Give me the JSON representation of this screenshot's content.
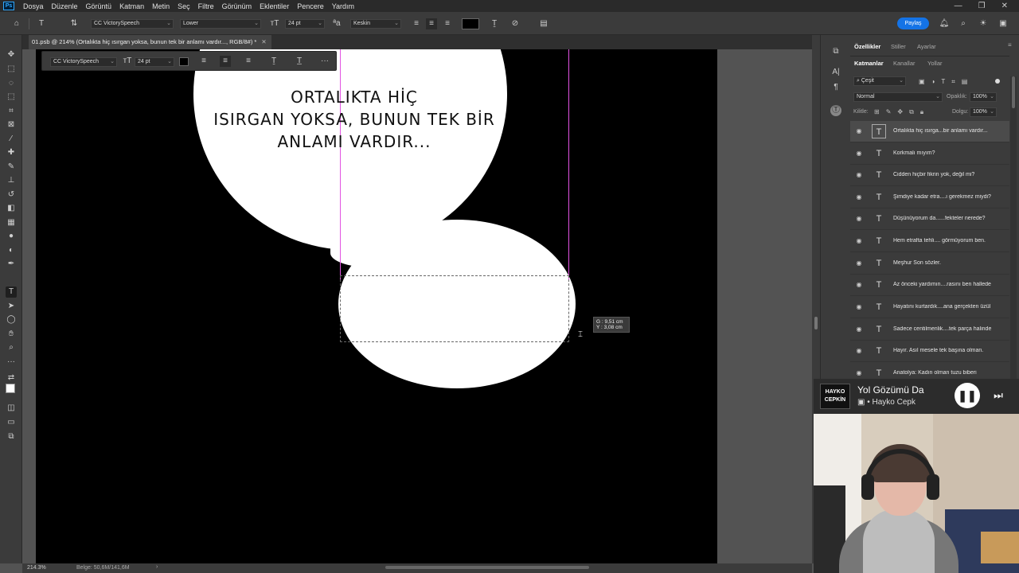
{
  "menubar": {
    "logo": "Ps",
    "items": [
      "Dosya",
      "Düzenle",
      "Görüntü",
      "Katman",
      "Metin",
      "Seç",
      "Filtre",
      "Görünüm",
      "Eklentiler",
      "Pencere",
      "Yardım"
    ]
  },
  "options": {
    "font_family": "CC VictorySpeech",
    "font_style": "Lower",
    "font_size": "24 pt",
    "antialias": "Keskin",
    "text_color": "#000000",
    "share_label": "Paylaş"
  },
  "document": {
    "tab_title": "01.psb @ 214% (Ortalıkta hiç ısırgan yoksa, bunun tek bir  anlamı vardır..., RGB/8#) *",
    "zoom": "214.3%",
    "doc_info": "Belge: 50,6M/141,6M"
  },
  "context_bar": {
    "font_family": "CC VictorySpeech",
    "font_size": "24 pt",
    "more": "···"
  },
  "canvas": {
    "bubble_text_lines": [
      "ORTALIKTA HİÇ",
      "ISIRGAN YOKSA, BUNUN TEK BİR",
      "ANLAMI VARDIR..."
    ],
    "measure_w": "G : 9,51 cm",
    "measure_h": "Y : 3,08 cm"
  },
  "panel": {
    "top_tabs": [
      "Özellikler",
      "Stiller",
      "Ayarlar"
    ],
    "layer_tabs": [
      "Katmanlar",
      "Kanallar",
      "Yollar"
    ],
    "filter_kind": "Çeşit",
    "blend_mode": "Normal",
    "opacity_label": "Opaklık:",
    "opacity_value": "100%",
    "lock_label": "Kilitle:",
    "fill_label": "Dolgu:",
    "fill_value": "100%",
    "layers": [
      "Ortalıkta hiç ısırga...bir  anlamı vardır...",
      "Korkmalı mıyım?",
      "Cidden hiçbir fikrin yok, değil mi?",
      "Şimdiye kadar etra....ı gerekmez miydi?",
      " Düşünüyorum da......fekteler nerede?",
      "Hem etrafta tehli.... görmüyorum ben.",
      "Meşhur  Son sözler.",
      "Az önceki yardımın....rasını ben hallede",
      "Hayatını kurtardık....ana gerçekten üzül",
      "Sadece centilmenlik....tek parça halinde",
      "Hayır. Asıl mesele tek başına olman.",
      "Anatolya: Kadın olman tuzu biberi"
    ]
  },
  "music": {
    "album_art_text": "HAYKO CEPKİN",
    "title": "Yol Gözümü Da",
    "artist": "• Hayko Cepk"
  },
  "colors": {
    "accent": "#1473e6",
    "guide": "#e254e2",
    "canvas_bg": "#000000",
    "bubble": "#ffffff"
  }
}
